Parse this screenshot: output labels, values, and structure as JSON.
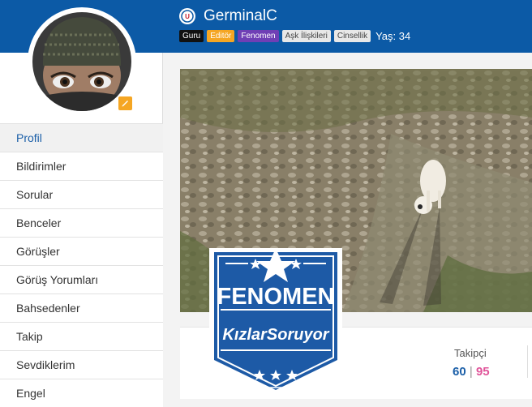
{
  "profile": {
    "username": "GerminalC",
    "age_text": "Yaş: 34",
    "badges": [
      {
        "label": "Guru",
        "bg": "#111111",
        "fg": "#ffffff"
      },
      {
        "label": "Editör",
        "bg": "#f5a623",
        "fg": "#ffffff"
      },
      {
        "label": "Fenomen",
        "bg": "#6f3fb5",
        "fg": "#ffffff"
      },
      {
        "label": "Aşk İlişkileri",
        "bg": "#e8e8e8",
        "fg": "#444444"
      },
      {
        "label": "Cinsellik",
        "bg": "#e8e8e8",
        "fg": "#444444"
      }
    ]
  },
  "sidebar": {
    "items": [
      {
        "label": "Profil",
        "active": true
      },
      {
        "label": "Bildirimler"
      },
      {
        "label": "Sorular"
      },
      {
        "label": "Benceler"
      },
      {
        "label": "Görüşler"
      },
      {
        "label": "Görüş Yorumları"
      },
      {
        "label": "Bahsedenler"
      },
      {
        "label": "Takip"
      },
      {
        "label": "Sevdiklerim"
      },
      {
        "label": "Engel"
      }
    ]
  },
  "stats": {
    "label": "Takipçi",
    "followers": "60",
    "separator": "|",
    "following": "95"
  },
  "fenomen_badge": {
    "title": "FENOMEN",
    "brand": "KızlarSoruyor"
  },
  "colors": {
    "header": "#0c5aa6",
    "followers": "#1b5fa8",
    "following": "#e0559a",
    "active_menu": "#1b5fa8"
  },
  "icons": [
    "user-type-icon",
    "edit-pencil-icon",
    "star-icon"
  ]
}
